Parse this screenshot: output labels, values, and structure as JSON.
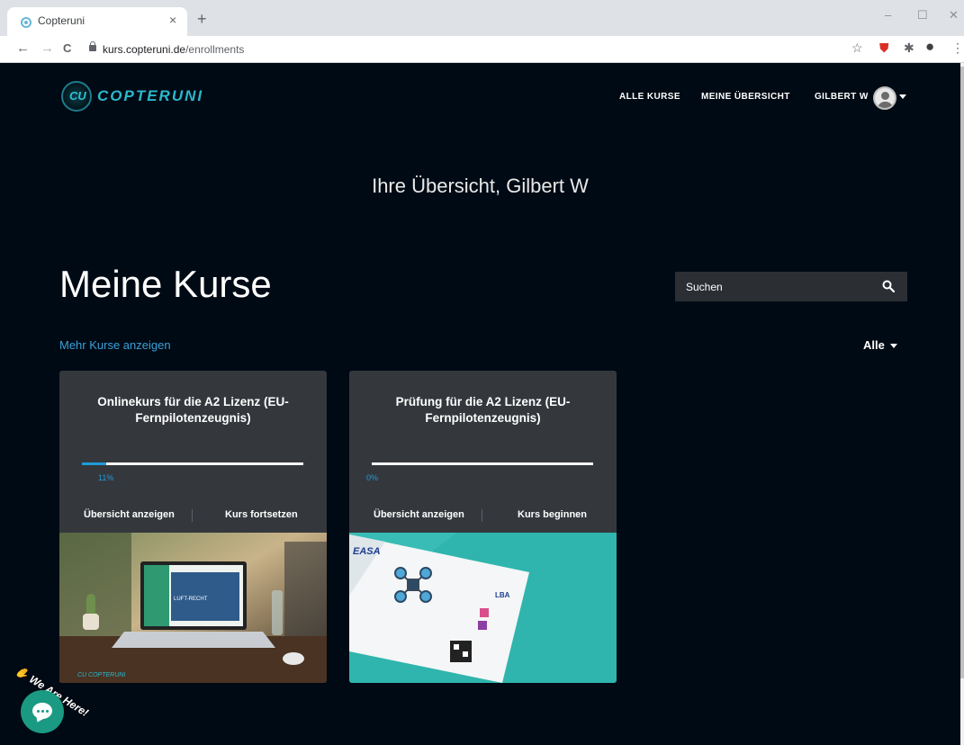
{
  "browser": {
    "tab_title": "Copteruni",
    "tab_close": "×",
    "new_tab": "+",
    "url_domain": "kurs.copteruni.de",
    "url_path": "/enrollments",
    "window_controls": [
      "–",
      "☐",
      "✕"
    ],
    "nav": {
      "back": "←",
      "forward": "→",
      "reload": "C"
    },
    "toolbar_icons": {
      "star": "☆",
      "shield": "⛊",
      "puzzle": "✱",
      "profile": "●",
      "menu": "⋮"
    }
  },
  "site": {
    "logo_text": "COPTERUNI",
    "logo_mark": "CU",
    "nav": [
      {
        "label": "ALLE KURSE"
      },
      {
        "label": "MEINE ÜBERSICHT"
      },
      {
        "label": "GILBERT W"
      }
    ]
  },
  "hero": {
    "title": "Ihre Übersicht, Gilbert W"
  },
  "section": {
    "title": "Meine Kurse",
    "search_placeholder": "Suchen",
    "more_link": "Mehr Kurse anzeigen",
    "filter": "Alle"
  },
  "courses": [
    {
      "title": "Onlinekurs für die A2 Lizenz (EU-Fernpilotenzeugnis)",
      "progress_label": "11%",
      "progress": 0.11,
      "action_overview": "Übersicht anzeigen",
      "action_primary": "Kurs fortsetzen",
      "image_tag": "CU COPTERUNI",
      "screen_text": "LUFT-RECHT"
    },
    {
      "title": "Prüfung für die A2 Lizenz (EU-Fernpilotenzeugnis)",
      "progress_label": "0%",
      "progress": 0,
      "action_overview": "Übersicht anzeigen",
      "action_primary": "Kurs beginnen",
      "image_brand_1": "EASA",
      "image_brand_2": "LBA"
    }
  ],
  "chat": {
    "tagline": "We Are Here!",
    "emoji": "✋"
  },
  "colors": {
    "page_bg": "#000a14",
    "card_bg": "#34383d",
    "accent": "#1e9bd7",
    "chat": "#1a9a82"
  }
}
